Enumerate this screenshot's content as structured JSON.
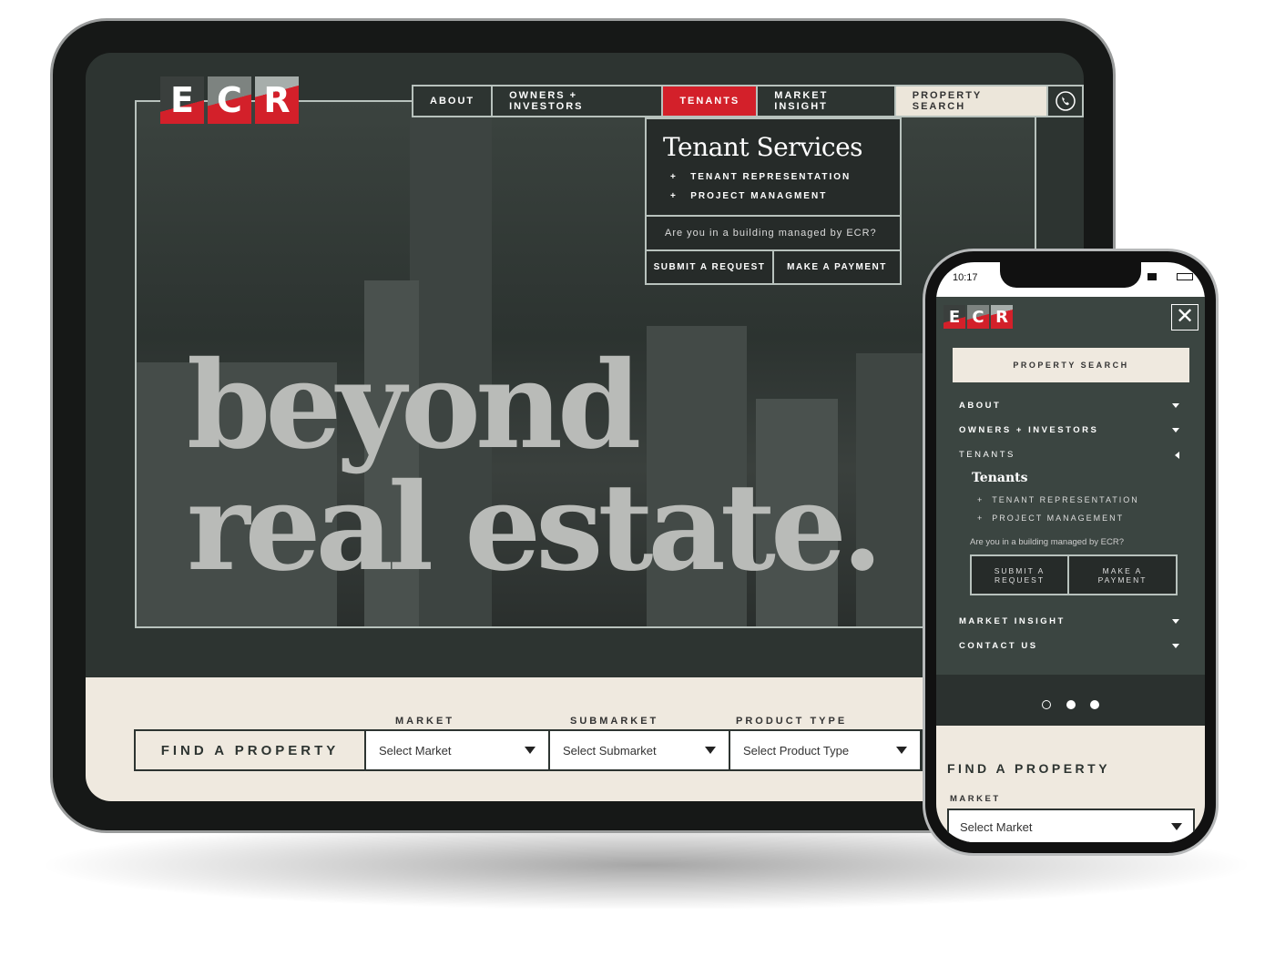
{
  "tablet": {
    "logo": [
      "E",
      "C",
      "R"
    ],
    "nav": [
      "ABOUT",
      "OWNERS + INVESTORS",
      "TENANTS",
      "MARKET INSIGHT",
      "PROPERTY SEARCH"
    ],
    "nav_icon": "phone-icon",
    "dropdown": {
      "title": "Tenant Services",
      "items": [
        "TENANT REPRESENTATION",
        "PROJECT MANAGMENT"
      ],
      "question": "Are you in a building managed by ECR?",
      "buttons": [
        "SUBMIT A REQUEST",
        "MAKE A PAYMENT"
      ]
    },
    "hero": {
      "line1": "beyond",
      "line2": "real estate."
    },
    "search": {
      "find_label": "FIND A PROPERTY",
      "filters": [
        {
          "label": "MARKET",
          "value": "Select Market"
        },
        {
          "label": "SUBMARKET",
          "value": "Select Submarket"
        },
        {
          "label": "PRODUCT TYPE",
          "value": "Select Product Type"
        }
      ]
    }
  },
  "phone": {
    "time": "10:17",
    "logo": [
      "E",
      "C",
      "R"
    ],
    "property_search": "PROPERTY SEARCH",
    "menu": [
      "ABOUT",
      "OWNERS + INVESTORS",
      "TENANTS",
      "MARKET INSIGHT",
      "CONTACT US"
    ],
    "tenants": {
      "title": "Tenants",
      "items": [
        "TENANT REPRESENTATION",
        "PROJECT MANAGEMENT"
      ],
      "question": "Are you in a building managed by ECR?",
      "buttons": [
        "SUBMIT A REQUEST",
        "MAKE A PAYMENT"
      ]
    },
    "find_label": "FIND A PROPERTY",
    "market_label": "MARKET",
    "market_value": "Select Market"
  },
  "colors": {
    "brand_red": "#d3202a",
    "dark": "#2d3431",
    "cream": "#efe9df"
  }
}
